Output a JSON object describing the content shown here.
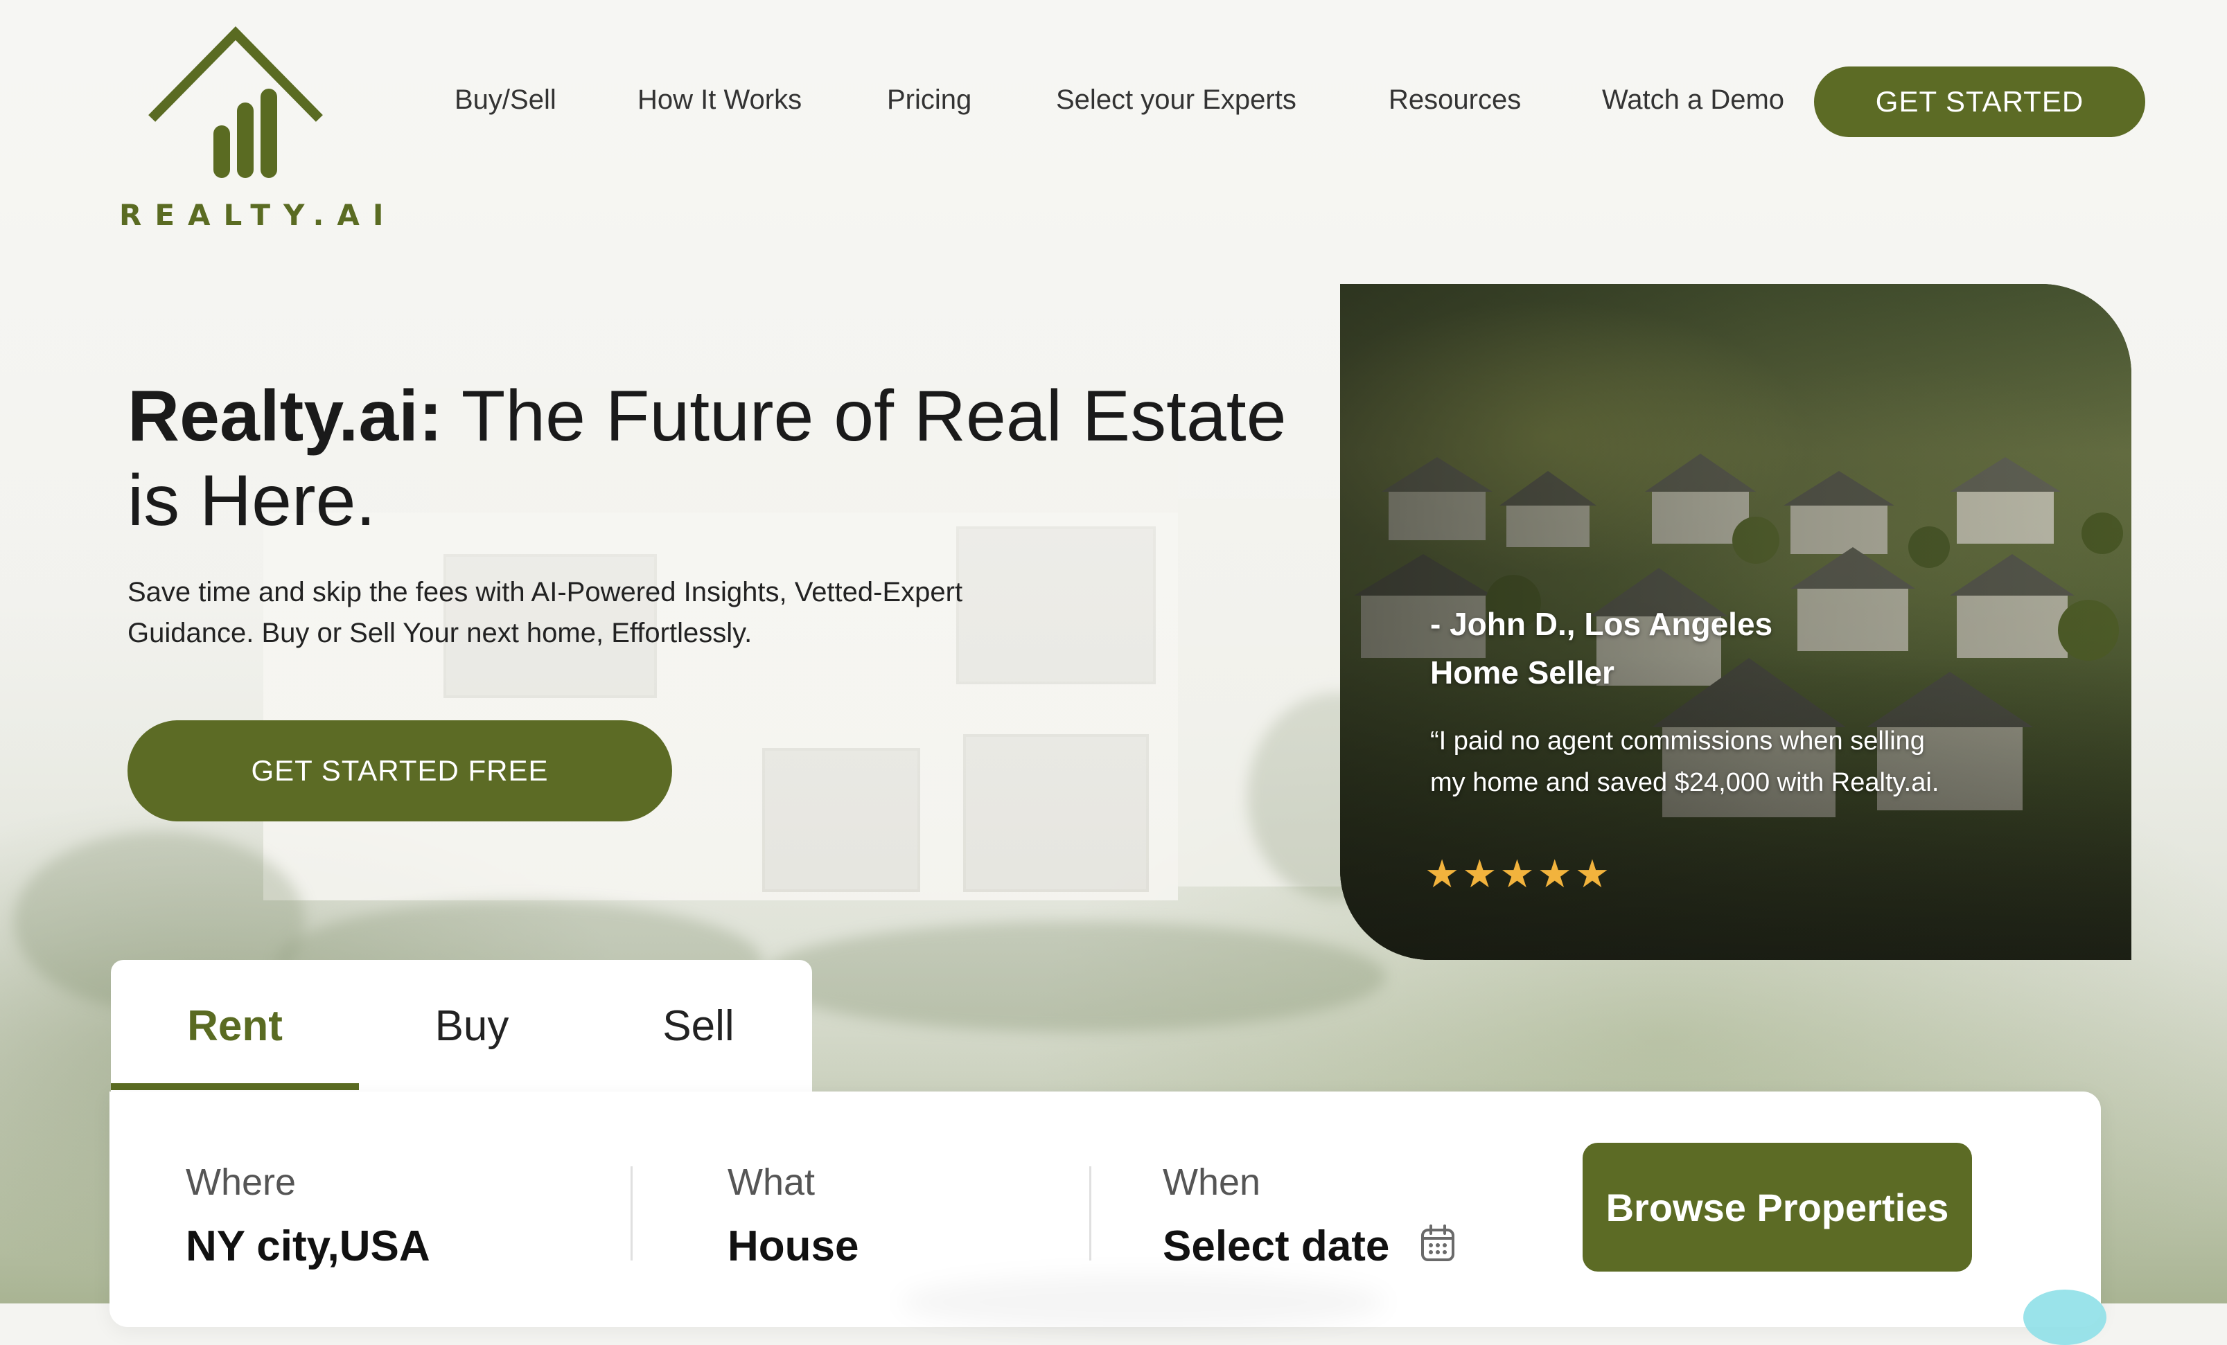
{
  "brand": {
    "logo_text": "REALTY.AI",
    "accent_color": "#5c6b25",
    "icon": "house-bars-logo-icon"
  },
  "nav": {
    "items": [
      {
        "label": "Buy/Sell"
      },
      {
        "label": "How It Works"
      },
      {
        "label": "Pricing"
      },
      {
        "label": "Select your Experts"
      },
      {
        "label": "Resources"
      },
      {
        "label": "Watch a Demo"
      }
    ],
    "cta_label": "GET STARTED"
  },
  "hero": {
    "title_bold": "Realty.ai:",
    "title_rest": " The Future of Real Estate is Here.",
    "subtitle": "Save time and skip the fees with AI-Powered Insights, Vetted-Expert Guidance. Buy or Sell Your next home, Effortlessly.",
    "cta_label": "GET STARTED FREE"
  },
  "testimonial": {
    "author": "- John D., Los Angeles",
    "role": "Home Seller",
    "quote": "“I paid no agent commissions when selling my home and saved $24,000 with Realty.ai.",
    "rating": 5,
    "stars": "★★★★★",
    "star_color": "#f2b33d"
  },
  "search": {
    "tabs": [
      {
        "label": "Rent",
        "active": true
      },
      {
        "label": "Buy",
        "active": false
      },
      {
        "label": "Sell",
        "active": false
      }
    ],
    "fields": {
      "where": {
        "label": "Where",
        "value": "NY city,USA"
      },
      "what": {
        "label": "What",
        "value": "House"
      },
      "when": {
        "label": "When",
        "value": "Select date",
        "icon": "calendar-icon"
      }
    },
    "button_label": "Browse Properties"
  }
}
